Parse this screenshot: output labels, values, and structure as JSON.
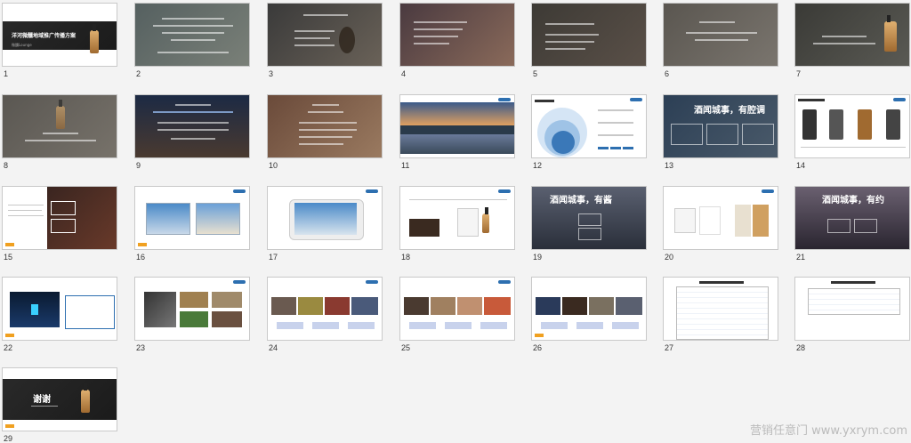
{
  "slides": [
    {
      "n": "1",
      "title": "洋河微醺地域推广传播方案",
      "sub": "微醺Lounge"
    },
    {
      "n": "2"
    },
    {
      "n": "3"
    },
    {
      "n": "4"
    },
    {
      "n": "5"
    },
    {
      "n": "6"
    },
    {
      "n": "7"
    },
    {
      "n": "8"
    },
    {
      "n": "9"
    },
    {
      "n": "10"
    },
    {
      "n": "11"
    },
    {
      "n": "12"
    },
    {
      "n": "13",
      "title": "酒闻城事，有腔调"
    },
    {
      "n": "14"
    },
    {
      "n": "15"
    },
    {
      "n": "16"
    },
    {
      "n": "17"
    },
    {
      "n": "18"
    },
    {
      "n": "19",
      "title": "酒闻城事，有酱"
    },
    {
      "n": "20"
    },
    {
      "n": "21",
      "title": "酒闻城事，有约"
    },
    {
      "n": "22"
    },
    {
      "n": "23"
    },
    {
      "n": "24"
    },
    {
      "n": "25"
    },
    {
      "n": "26"
    },
    {
      "n": "27"
    },
    {
      "n": "28"
    },
    {
      "n": "29",
      "title": "谢谢"
    }
  ],
  "watermark": "营销任意门 www.yxrym.com",
  "colors": {
    "accent": "#2d6fb0",
    "stamp": "#f0a020"
  }
}
